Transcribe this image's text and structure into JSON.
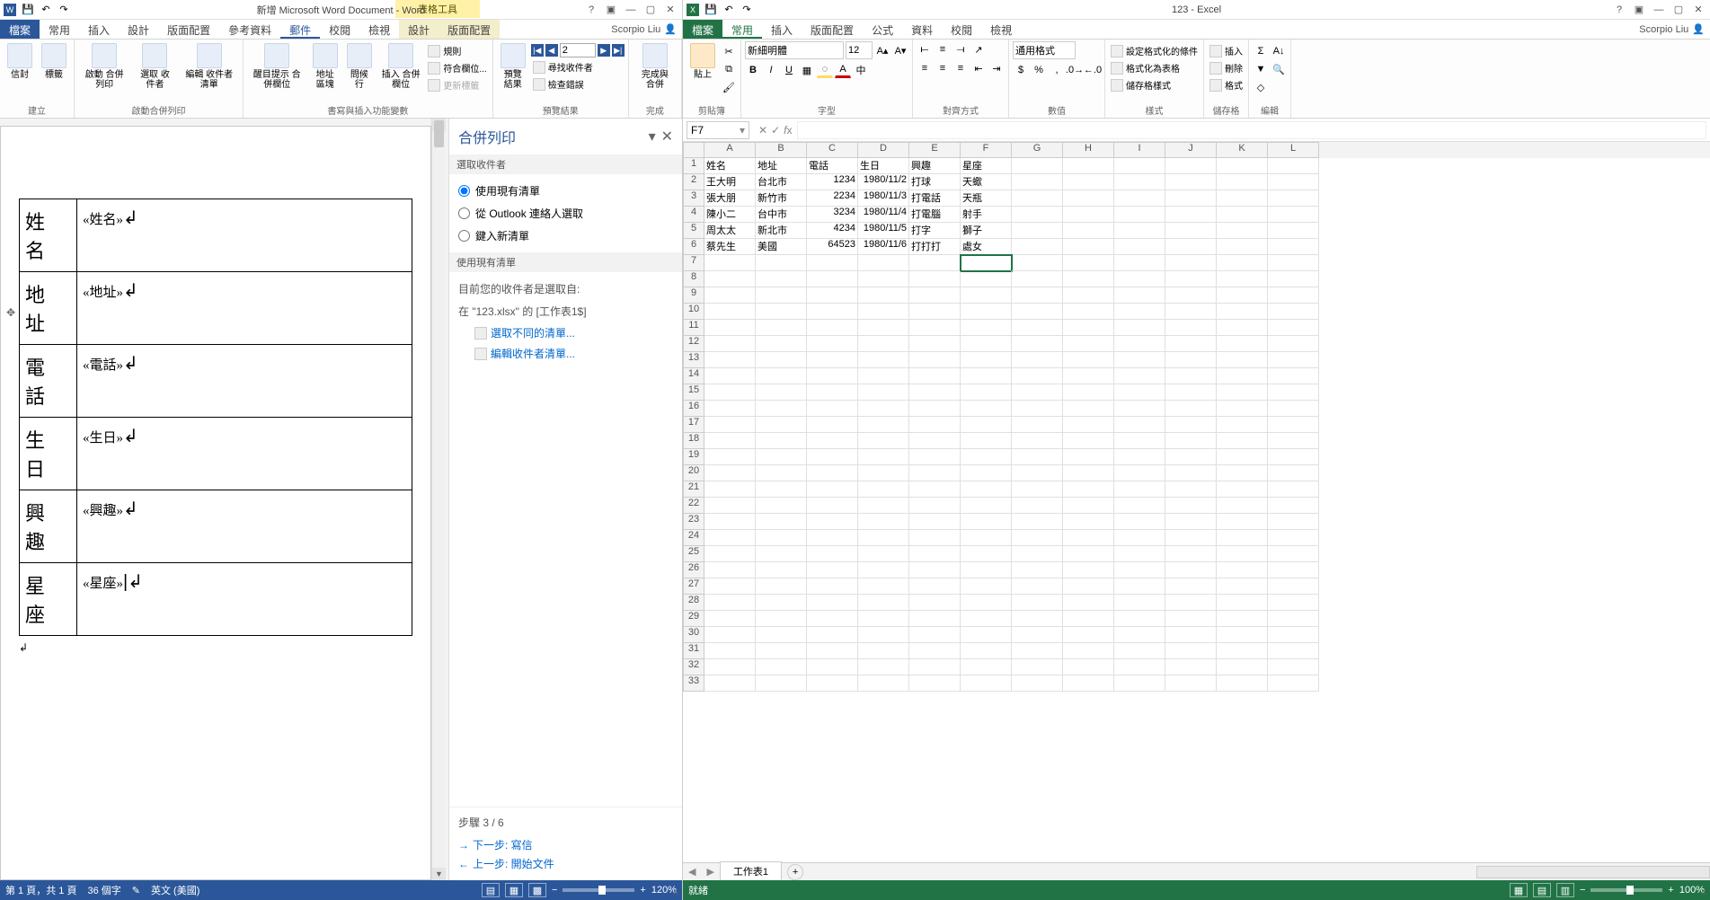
{
  "word": {
    "title": "新增 Microsoft Word Document - Word",
    "contextual_tab": "表格工具",
    "user": "Scorpio Liu",
    "tabs": [
      "檔案",
      "常用",
      "插入",
      "設計",
      "版面配置",
      "參考資料",
      "郵件",
      "校閱",
      "檢視",
      "設計",
      "版面配置"
    ],
    "active_tab_index": 6,
    "ribbon": {
      "g1": {
        "label": "建立",
        "btns": [
          "信封",
          "標籤"
        ]
      },
      "g2": {
        "label": "啟動合併列印",
        "btns": [
          "啟動\n合併列印",
          "選取\n收件者",
          "編輯\n收件者清單"
        ]
      },
      "g3": {
        "label": "書寫與插入功能變數",
        "btns": [
          "醒目提示\n合併欄位",
          "地址區塊",
          "問候行",
          "插入\n合併欄位"
        ],
        "small": [
          "規則",
          "符合欄位...",
          "更新標籤"
        ]
      },
      "g4": {
        "label": "預覽結果",
        "btn": "預覽結果",
        "rec": "2",
        "small": [
          "尋找收件者",
          "檢查錯誤"
        ]
      },
      "g5": {
        "label": "完成",
        "btn": "完成與\n合併"
      }
    },
    "doc": {
      "rows": [
        {
          "label": "姓名",
          "field": "«姓名»"
        },
        {
          "label": "地址",
          "field": "«地址»"
        },
        {
          "label": "電話",
          "field": "«電話»"
        },
        {
          "label": "生日",
          "field": "«生日»"
        },
        {
          "label": "興趣",
          "field": "«興趣»"
        },
        {
          "label": "星座",
          "field": "«星座»"
        }
      ]
    },
    "pane": {
      "title": "合併列印",
      "section1": "選取收件者",
      "radios": [
        "使用現有清單",
        "從 Outlook 連絡人選取",
        "鍵入新清單"
      ],
      "section2": "使用現有清單",
      "info1": "目前您的收件者是選取自:",
      "info2": "在 \"123.xlsx\" 的 [工作表1$]",
      "link1": "選取不同的清單...",
      "link2": "編輯收件者清單...",
      "step": "步驟 3 / 6",
      "next": "下一步: 寫信",
      "prev": "上一步: 開始文件"
    },
    "status": {
      "page": "第 1 頁，共 1 頁",
      "words": "36 個字",
      "lang": "英文 (美國)",
      "zoom": "120%"
    }
  },
  "excel": {
    "title": "123 - Excel",
    "user": "Scorpio Liu",
    "tabs": [
      "檔案",
      "常用",
      "插入",
      "版面配置",
      "公式",
      "資料",
      "校閱",
      "檢視"
    ],
    "active_tab_index": 1,
    "ribbon": {
      "clipboard": {
        "label": "剪貼簿",
        "paste": "貼上"
      },
      "font": {
        "label": "字型",
        "name": "新細明體",
        "size": "12"
      },
      "align": {
        "label": "對齊方式"
      },
      "number": {
        "label": "數值",
        "format": "通用格式"
      },
      "styles": {
        "label": "樣式",
        "btns": [
          "設定格式化的條件",
          "格式化為表格",
          "儲存格樣式"
        ]
      },
      "cells": {
        "label": "儲存格",
        "btns": [
          "插入",
          "刪除",
          "格式"
        ]
      },
      "editing": {
        "label": "編輯"
      }
    },
    "namebox": "F7",
    "cols": [
      "A",
      "B",
      "C",
      "D",
      "E",
      "F",
      "G",
      "H",
      "I",
      "J",
      "K",
      "L"
    ],
    "data": {
      "headers": [
        "姓名",
        "地址",
        "電話",
        "生日",
        "興趣",
        "星座"
      ],
      "rows": [
        [
          "王大明",
          "台北市",
          "1234",
          "1980/11/2",
          "打球",
          "天蠍"
        ],
        [
          "張大朋",
          "新竹市",
          "2234",
          "1980/11/3",
          "打電話",
          "天瓶"
        ],
        [
          "陳小二",
          "台中市",
          "3234",
          "1980/11/4",
          "打電腦",
          "射手"
        ],
        [
          "周太太",
          "新北市",
          "4234",
          "1980/11/5",
          "打字",
          "獅子"
        ],
        [
          "蔡先生",
          "美國",
          "64523",
          "1980/11/6",
          "打打打",
          "處女"
        ]
      ]
    },
    "sheet": "工作表1",
    "status": {
      "ready": "就緒",
      "zoom": "100%"
    }
  }
}
